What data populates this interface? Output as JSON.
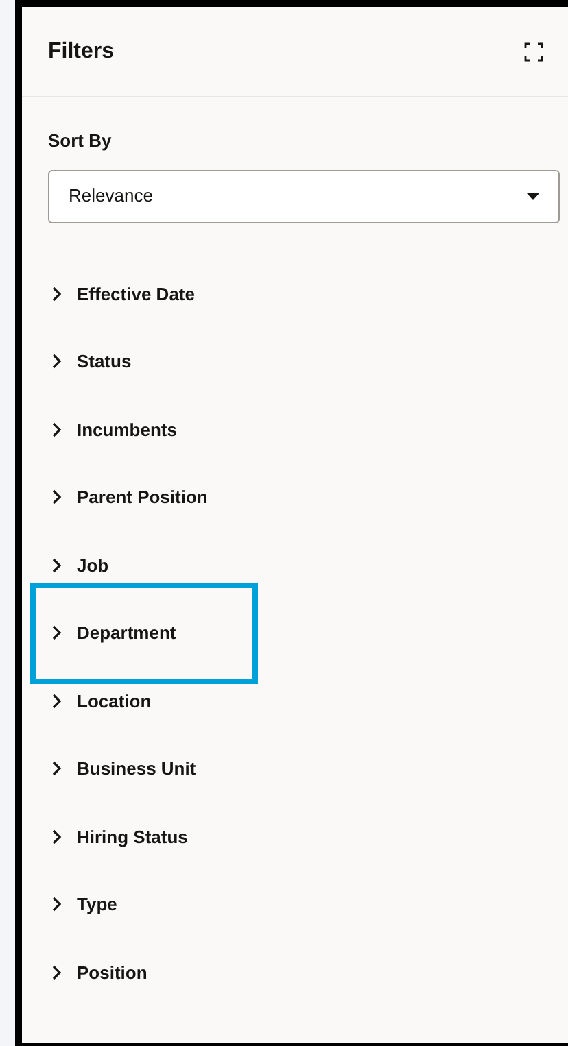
{
  "panel": {
    "title": "Filters"
  },
  "sort": {
    "label": "Sort By",
    "value": "Relevance"
  },
  "filters": [
    {
      "label": "Effective Date",
      "highlighted": false
    },
    {
      "label": "Status",
      "highlighted": false
    },
    {
      "label": "Incumbents",
      "highlighted": false
    },
    {
      "label": "Parent Position",
      "highlighted": false
    },
    {
      "label": "Job",
      "highlighted": false
    },
    {
      "label": "Department",
      "highlighted": true
    },
    {
      "label": "Location",
      "highlighted": false
    },
    {
      "label": "Business Unit",
      "highlighted": false
    },
    {
      "label": "Hiring Status",
      "highlighted": false
    },
    {
      "label": "Type",
      "highlighted": false
    },
    {
      "label": "Position",
      "highlighted": false
    }
  ]
}
